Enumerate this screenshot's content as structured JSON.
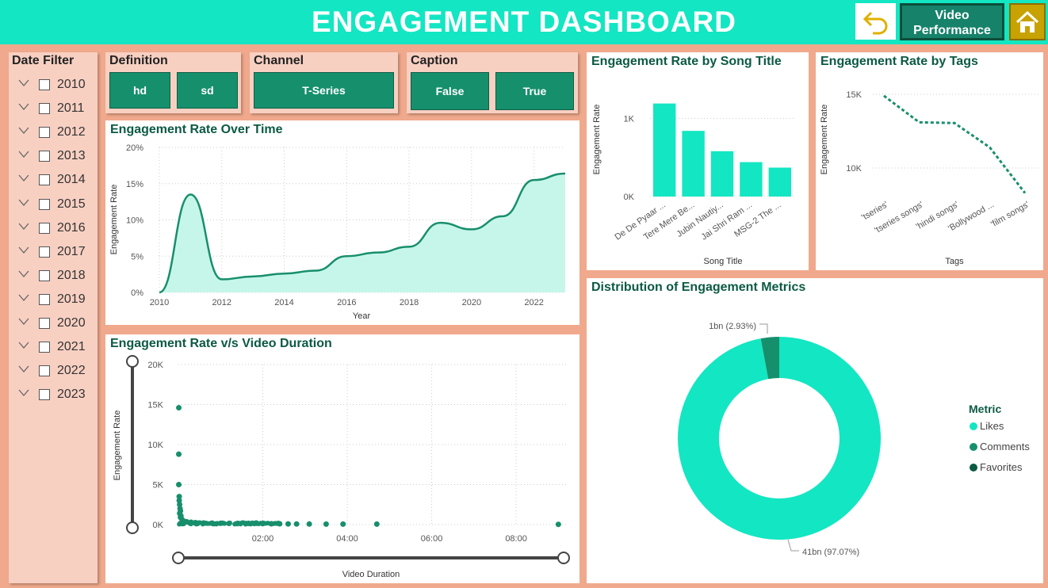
{
  "header": {
    "title": "ENGAGEMENT DASHBOARD",
    "video_btn": "Video Performance",
    "accent": "#13e6c2"
  },
  "date_filter": {
    "title": "Date Filter",
    "years": [
      "2010",
      "2011",
      "2012",
      "2013",
      "2014",
      "2015",
      "2016",
      "2017",
      "2018",
      "2019",
      "2020",
      "2021",
      "2022",
      "2023"
    ]
  },
  "slicers": {
    "definition": {
      "label": "Definition",
      "options": [
        "hd",
        "sd"
      ]
    },
    "channel": {
      "label": "Channel",
      "options": [
        "T-Series"
      ]
    },
    "caption": {
      "label": "Caption",
      "options": [
        "False",
        "True"
      ]
    }
  },
  "chart_data": [
    {
      "type": "area",
      "title": "Engagement Rate Over Time",
      "xlabel": "Year",
      "ylabel": "Engagement Rate",
      "x": [
        2010,
        2011,
        2012,
        2013,
        2014,
        2015,
        2016,
        2017,
        2018,
        2019,
        2020,
        2021,
        2022,
        2023
      ],
      "values": [
        0,
        13.5,
        1.8,
        2.2,
        2.6,
        3.0,
        5.0,
        5.5,
        6.3,
        9.6,
        8.7,
        10.5,
        15.5,
        16.4
      ],
      "x_ticks": [
        "2010",
        "2012",
        "2014",
        "2016",
        "2018",
        "2020",
        "2022"
      ],
      "y_ticks": [
        "0%",
        "5%",
        "10%",
        "15%",
        "20%"
      ],
      "ylim": [
        0,
        20
      ],
      "color": "#188f6c"
    },
    {
      "type": "bar",
      "title": "Engagement Rate by Song Title",
      "xlabel": "Song Title",
      "ylabel": "Engagement Rate",
      "categories": [
        "De De Pyaar ...",
        "Tere Mere Be...",
        "Jubin Nautiy...",
        "Jai Shri Ram ...",
        "MSG-2 The ..."
      ],
      "values": [
        1190,
        840,
        580,
        440,
        370
      ],
      "y_ticks": [
        "0K",
        "1K"
      ],
      "color": "#13e6c2"
    },
    {
      "type": "line",
      "title": "Engagement Rate by Tags",
      "xlabel": "Tags",
      "ylabel": "Engagement Rate",
      "categories": [
        "'tseries'",
        "'tseries songs'",
        "'hindi songs'",
        "'Bollywood ...",
        "'film songs'"
      ],
      "values": [
        14900,
        13100,
        13050,
        11400,
        8300
      ],
      "y_ticks": [
        "10K",
        "15K"
      ],
      "color": "#188f6c"
    },
    {
      "type": "scatter",
      "title": "Engagement Rate v/s Video Duration",
      "xlabel": "Video Duration",
      "ylabel": "Engagement Rate",
      "x_ticks": [
        "02:00",
        "04:00",
        "06:00",
        "08:00"
      ],
      "y_ticks": [
        "0K",
        "5K",
        "10K",
        "15K",
        "20K"
      ],
      "ylim": [
        0,
        20000
      ],
      "xlim_minutes": [
        0,
        9.2
      ],
      "points": [
        [
          0.01,
          14600
        ],
        [
          0.01,
          8800
        ],
        [
          0.01,
          5000
        ],
        [
          0.02,
          3500
        ],
        [
          0.02,
          3000
        ],
        [
          0.03,
          2500
        ],
        [
          0.04,
          2000
        ],
        [
          0.05,
          1700
        ],
        [
          0.03,
          1400
        ],
        [
          0.06,
          1100
        ],
        [
          0.05,
          900
        ],
        [
          0.08,
          700
        ],
        [
          0.1,
          500
        ],
        [
          0.15,
          400
        ],
        [
          0.2,
          350
        ],
        [
          0.3,
          300
        ],
        [
          0.4,
          250
        ],
        [
          0.6,
          200
        ],
        [
          0.8,
          180
        ],
        [
          1.0,
          160
        ],
        [
          1.2,
          150
        ],
        [
          1.4,
          140
        ],
        [
          1.6,
          140
        ],
        [
          1.8,
          130
        ],
        [
          2.0,
          120
        ],
        [
          2.2,
          110
        ],
        [
          2.4,
          100
        ],
        [
          2.6,
          90
        ],
        [
          2.8,
          80
        ],
        [
          3.1,
          70
        ],
        [
          3.5,
          60
        ],
        [
          3.9,
          60
        ],
        [
          4.7,
          60
        ],
        [
          9.0,
          30
        ]
      ],
      "color": "#188f6c"
    },
    {
      "type": "pie",
      "title": "Distribution of Engagement Metrics",
      "legend_title": "Metric",
      "slices": [
        {
          "name": "Likes",
          "value": 97.07,
          "label": "41bn (97.07%)",
          "color": "#13e6c2"
        },
        {
          "name": "Comments",
          "value": 2.93,
          "label": "1bn (2.93%)",
          "color": "#16906c"
        },
        {
          "name": "Favorites",
          "value": 0,
          "label": "",
          "color": "#0b5a44"
        }
      ]
    }
  ]
}
